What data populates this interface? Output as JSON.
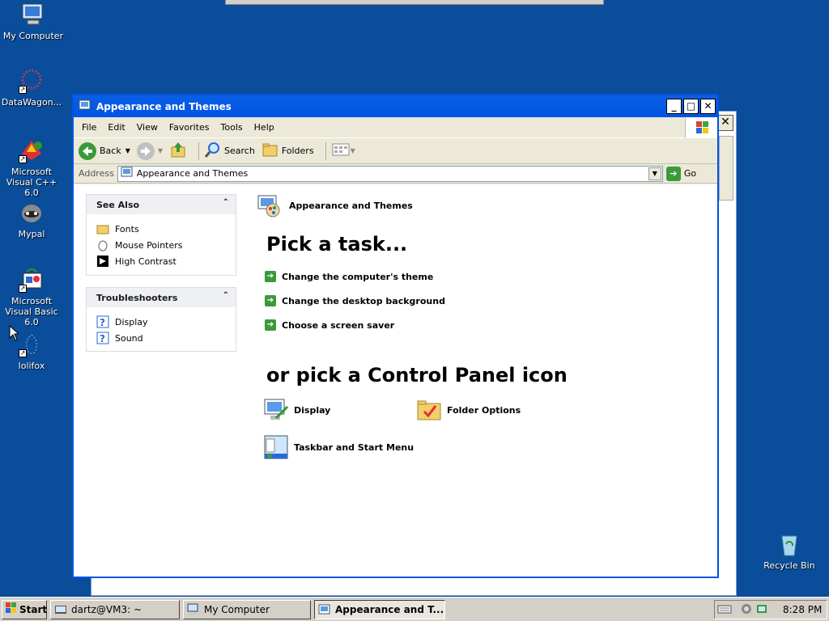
{
  "desktop": {
    "icons": [
      {
        "label": "My Computer"
      },
      {
        "label": "DataWagon..."
      },
      {
        "label": "Microsoft Visual C++ 6.0"
      },
      {
        "label": "Mypal"
      },
      {
        "label": "Microsoft Visual Basic 6.0"
      },
      {
        "label": "lolifox"
      },
      {
        "label": "Recycle Bin"
      }
    ]
  },
  "window": {
    "title": "Appearance and Themes",
    "menu": [
      "File",
      "Edit",
      "View",
      "Favorites",
      "Tools",
      "Help"
    ],
    "toolbar": {
      "back": "Back",
      "search": "Search",
      "folders": "Folders"
    },
    "address": {
      "label": "Address",
      "value": "Appearance and Themes",
      "go": "Go"
    }
  },
  "sidebar": {
    "see_also": {
      "title": "See Also",
      "items": [
        "Fonts",
        "Mouse Pointers",
        "High Contrast"
      ]
    },
    "troubleshooters": {
      "title": "Troubleshooters",
      "items": [
        "Display",
        "Sound"
      ]
    }
  },
  "main": {
    "category_title": "Appearance and Themes",
    "pick_task_heading": "Pick a task...",
    "tasks": [
      "Change the computer's theme",
      "Change the desktop background",
      "Choose a screen saver"
    ],
    "pick_icon_heading": "or pick a Control Panel icon",
    "icons": [
      "Display",
      "Folder Options",
      "Taskbar and Start Menu"
    ]
  },
  "taskbar": {
    "start": "Start",
    "buttons": [
      "dartz@VM3: ~",
      "My Computer",
      "Appearance and T..."
    ],
    "clock": "8:28 PM"
  },
  "colors": {
    "desktop": "#0a4d9a",
    "titlebar": "#0054e3",
    "accent_green": "#3a9a3a"
  }
}
